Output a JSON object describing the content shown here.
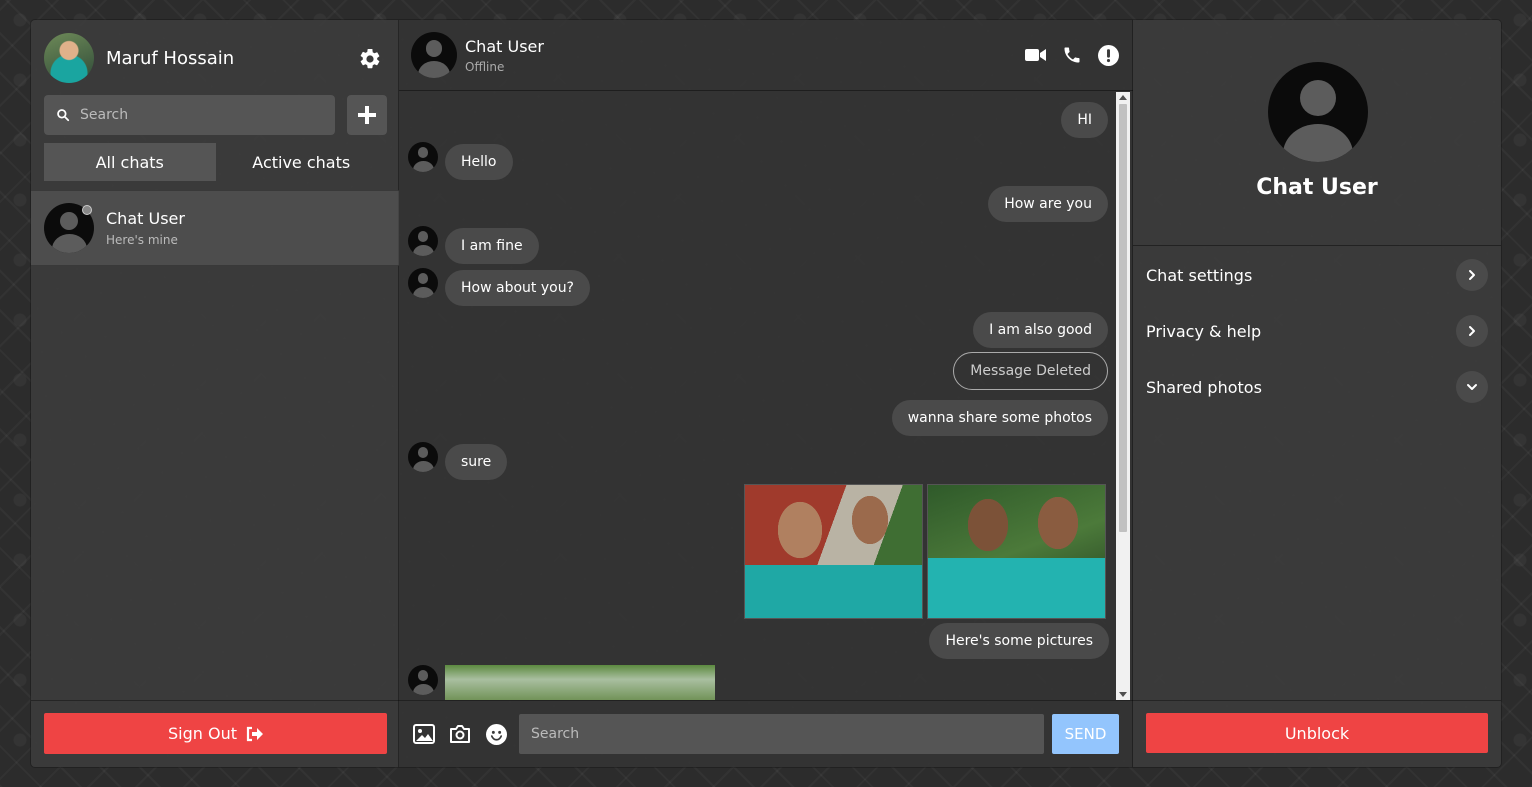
{
  "profile": {
    "name": "Maruf Hossain"
  },
  "sidebar": {
    "search_placeholder": "Search",
    "tabs": [
      {
        "label": "All chats",
        "active": true
      },
      {
        "label": "Active chats",
        "active": false
      }
    ],
    "chats": [
      {
        "name": "Chat User",
        "preview": "Here's mine",
        "status": "offline"
      }
    ],
    "signout_label": "Sign Out"
  },
  "chat": {
    "header": {
      "name": "Chat User",
      "status": "Offline"
    },
    "messages": [
      {
        "text": "HI",
        "direction": "out"
      },
      {
        "text": "Hello",
        "direction": "in"
      },
      {
        "text": "How are you",
        "direction": "out"
      },
      {
        "text": "I am fine",
        "direction": "in"
      },
      {
        "text": "How about you?",
        "direction": "in"
      },
      {
        "text": "I am also good",
        "direction": "out"
      },
      {
        "text": "Message Deleted",
        "direction": "out",
        "deleted": true
      },
      {
        "text": "wanna share some photos",
        "direction": "out"
      },
      {
        "text": "sure",
        "direction": "in"
      },
      {
        "text": "Here's some pictures",
        "direction": "out"
      }
    ],
    "composer": {
      "placeholder": "Search",
      "send_label": "SEND"
    }
  },
  "details": {
    "name": "Chat User",
    "options": [
      {
        "label": "Chat settings",
        "icon": "chevron-right-icon"
      },
      {
        "label": "Privacy & help",
        "icon": "chevron-right-icon"
      },
      {
        "label": "Shared photos",
        "icon": "chevron-down-icon"
      }
    ],
    "unblock_label": "Unblock"
  },
  "colors": {
    "danger": "#ef4444",
    "send_button": "#93c5fd",
    "bubble": "#4a4a4a"
  }
}
